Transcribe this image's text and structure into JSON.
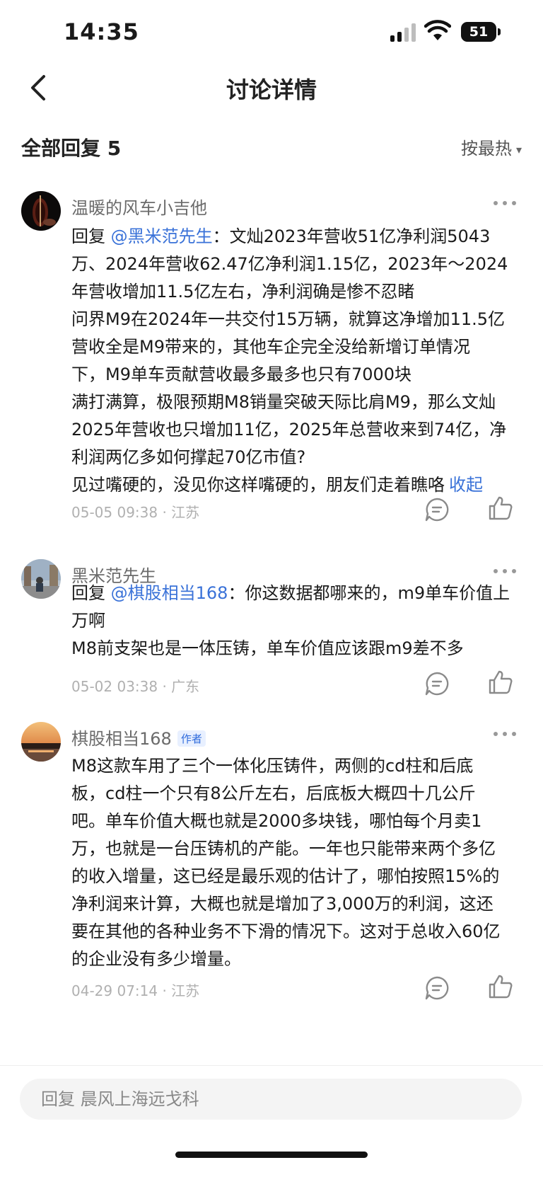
{
  "status_bar": {
    "time": "14:35",
    "battery": "51"
  },
  "nav": {
    "title": "讨论详情"
  },
  "replies": {
    "title": "全部回复 5",
    "sort_label": "按最热",
    "sort_caret": "▾"
  },
  "comments": [
    {
      "author": "温暖的风车小吉他",
      "reply_prefix": "回复 ",
      "mention": "@黑米范先生",
      "lines": [
        "：文灿2023年营收51亿净利润5043",
        "万、2024年营收62.47亿净利润1.15亿，2023年～2024",
        "年营收增加11.5亿左右，净利润确是惨不忍睹",
        "问界M9在2024年一共交付15万辆，就算这净增加11.5亿",
        "营收全是M9带来的，其他车企完全没给新增订单情况",
        "下，M9单车贡献营收最多最多也只有7000块",
        "满打满算，极限预期M8销量突破天际比肩M9，那么文灿",
        "2025年营收也只增加11亿，2025年总营收来到74亿，净",
        "利润两亿多如何撑起70亿市值?",
        "见过嘴硬的，没见你这样嘴硬的，朋友们走着瞧咯"
      ],
      "collapse_label": "收起",
      "meta": "05-05 09:38 · 江苏"
    },
    {
      "author": "黑米范先生",
      "reply_prefix": "回复 ",
      "mention": "@棋股相当168",
      "lines": [
        "：你这数据都哪来的，m9单车价值上",
        "万啊",
        "M8前支架也是一体压铸，单车价值应该跟m9差不多"
      ],
      "meta": "05-02 03:38 · 广东"
    },
    {
      "author": "棋股相当168",
      "badge": "作者",
      "lines": [
        "M8这款车用了三个一体化压铸件，两侧的cd柱和后底",
        "板，cd柱一个只有8公斤左右，后底板大概四十几公斤",
        "吧。单车价值大概也就是2000多块钱，哪怕每个月卖1",
        "万，也就是一台压铸机的产能。一年也只能带来两个多亿",
        "的收入增量，这已经是最乐观的估计了，哪怕按照15%的",
        "净利润来计算，大概也就是增加了3,000万的利润，这还",
        "要在其他的各种业务不下滑的情况下。这对于总收入60亿",
        "的企业没有多少增量。"
      ],
      "meta": "04-29 07:14 · 江苏"
    }
  ],
  "input": {
    "placeholder": "回复 晨风上海远戈科"
  },
  "icons": {
    "back": "chevron-left-icon",
    "more": "more-dots-icon",
    "reply": "comment-bubble-icon",
    "like": "thumbs-up-icon",
    "signal": "cellular-signal-icon",
    "wifi": "wifi-icon",
    "battery": "battery-icon"
  },
  "colors": {
    "mention": "#3a72d8",
    "meta": "#b0b0b0",
    "author": "#6b6b6b",
    "badge": "#2f6bdc"
  }
}
